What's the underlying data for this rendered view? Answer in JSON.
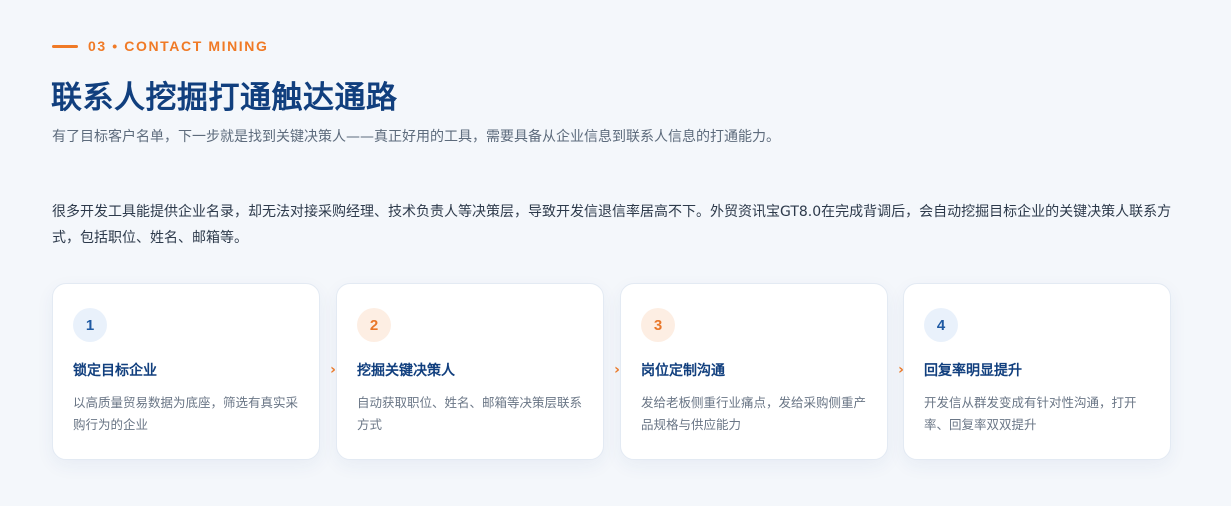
{
  "eyebrow": "03 • CONTACT MINING",
  "title": "联系人挖掘打通触达通路",
  "subtitle": "有了目标客户名单，下一步就是找到关键决策人——真正好用的工具，需要具备从企业信息到联系人信息的打通能力。",
  "body": "很多开发工具能提供企业名录，却无法对接采购经理、技术负责人等决策层，导致开发信退信率居高不下。外贸资讯宝GT8.0在完成背调后，会自动挖掘目标企业的关键决策人联系方式，包括职位、姓名、邮箱等。",
  "arrow_glyph": "›",
  "steps": [
    {
      "num": "1",
      "title": "锁定目标企业",
      "desc": "以高质量贸易数据为底座，筛选有真实采购行为的企业",
      "tone": "blue"
    },
    {
      "num": "2",
      "title": "挖掘关键决策人",
      "desc": "自动获取职位、姓名、邮箱等决策层联系方式",
      "tone": "orange"
    },
    {
      "num": "3",
      "title": "岗位定制沟通",
      "desc": "发给老板侧重行业痛点，发给采购侧重产品规格与供应能力",
      "tone": "orange"
    },
    {
      "num": "4",
      "title": "回复率明显提升",
      "desc": "开发信从群发变成有针对性沟通，打开率、回复率双双提升",
      "tone": "blue"
    }
  ],
  "colors": {
    "accent": "#f07a26",
    "title": "#113f7e",
    "background": "#f4f7fb"
  }
}
